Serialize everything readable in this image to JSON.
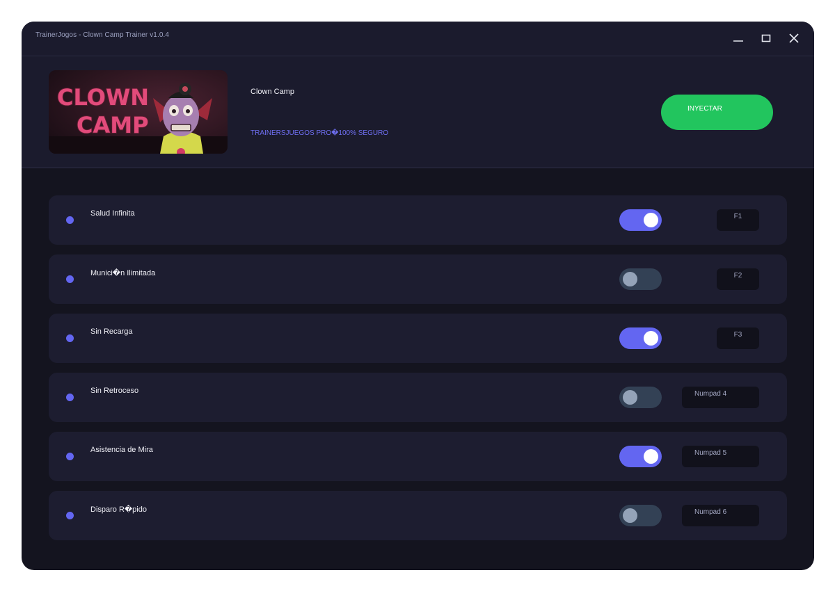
{
  "window": {
    "title": "TrainerJogos - Clown Camp Trainer v1.0.4",
    "controls": [
      "minimize",
      "maximize",
      "close"
    ]
  },
  "header": {
    "game_image_text_line1": "CLOWN",
    "game_image_text_line2": "CAMP",
    "game_name": "Clown Camp",
    "tagline": "TRAINERSJUEGOS PRO�100% SEGURO",
    "inject_label": "INYECTAR"
  },
  "colors": {
    "accent": "#6366f1",
    "inject": "#22c55e",
    "toggle_off": "#334155"
  },
  "cheats": [
    {
      "label": "Salud Infinita",
      "enabled": true,
      "hotkey": "F1"
    },
    {
      "label": "Munici�n Ilimitada",
      "enabled": false,
      "hotkey": "F2"
    },
    {
      "label": "Sin Recarga",
      "enabled": true,
      "hotkey": "F3"
    },
    {
      "label": "Sin Retroceso",
      "enabled": false,
      "hotkey": "Numpad 4"
    },
    {
      "label": "Asistencia de Mira",
      "enabled": true,
      "hotkey": "Numpad 5"
    },
    {
      "label": "Disparo R�pido",
      "enabled": false,
      "hotkey": "Numpad 6"
    }
  ]
}
